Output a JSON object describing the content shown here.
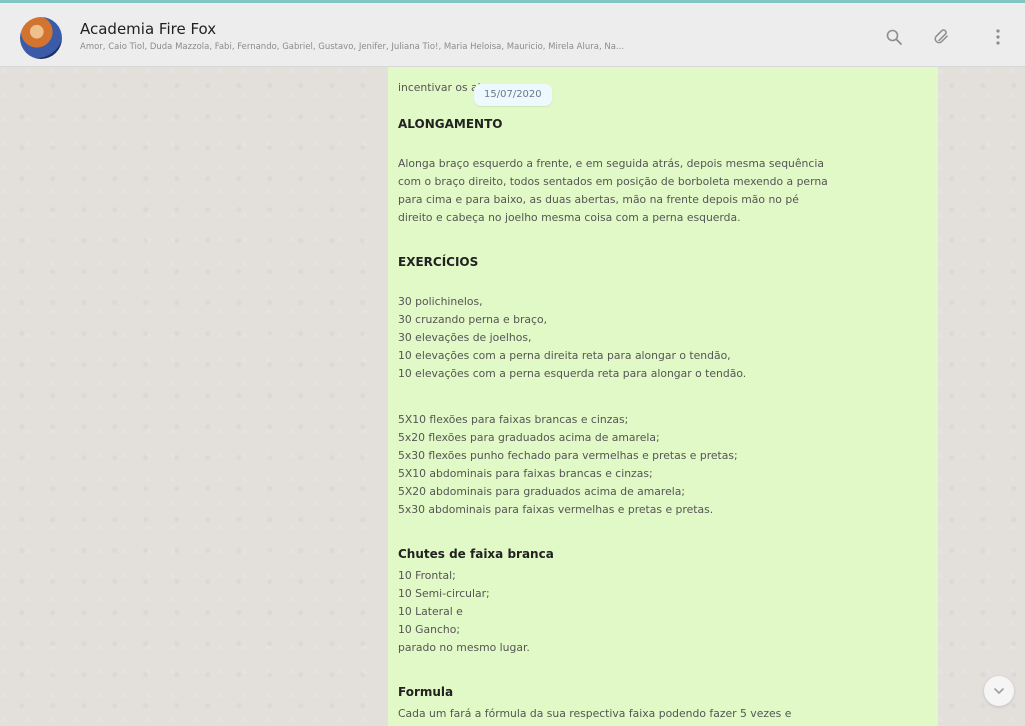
{
  "header": {
    "title": "Academia Fire Fox",
    "members": "Amor, Caio Tiol, Duda Mazzola, Fabi, Fernando, Gabriel, Gustavo, Jenifer, Juliana Tio!, Maria Heloisa, Mauricio, Mirela Alura, Na..."
  },
  "chat": {
    "date": "15/07/2020",
    "message": {
      "intro": "incentivar os alunos.",
      "alongamento_title": "ALONGAMENTO",
      "alongamento_lines": [
        "Alonga braço esquerdo a frente, e em seguida atrás, depois mesma sequência",
        "com o braço direito, todos sentados em posição de borboleta mexendo a perna",
        "para cima e para baixo, as duas abertas, mão na frente depois mão no pé",
        "direito e cabeça no joelho mesma coisa com a perna esquerda."
      ],
      "exercicios_title": "EXERCÍCIOS",
      "exercicios_lines": [
        "30 polichinelos,",
        "30 cruzando perna e braço,",
        "30 elevações de joelhos,",
        "10 elevações com a perna direita reta para alongar o tendão,",
        "10 elevações com a perna esquerda reta para alongar o tendão."
      ],
      "flexoes_lines": [
        "5X10 flexões para faixas brancas e cinzas;",
        "5x20 flexões para graduados acima de amarela;",
        "5x30 flexões punho fechado para vermelhas e pretas e pretas;",
        "5X10 abdominais para faixas brancas e cinzas;",
        "5X20 abdominais para graduados acima de amarela;",
        "5x30 abdominais para faixas vermelhas e pretas e pretas."
      ],
      "chutes_title": "Chutes de faixa branca",
      "chutes_lines": [
        "10 Frontal;",
        "10 Semi-circular;",
        "10 Lateral e",
        "10 Gancho;",
        "parado no mesmo lugar."
      ],
      "formula_title": "Formula",
      "formula_line": "Cada um fará a fórmula da sua respectiva faixa podendo fazer 5 vezes e"
    }
  }
}
